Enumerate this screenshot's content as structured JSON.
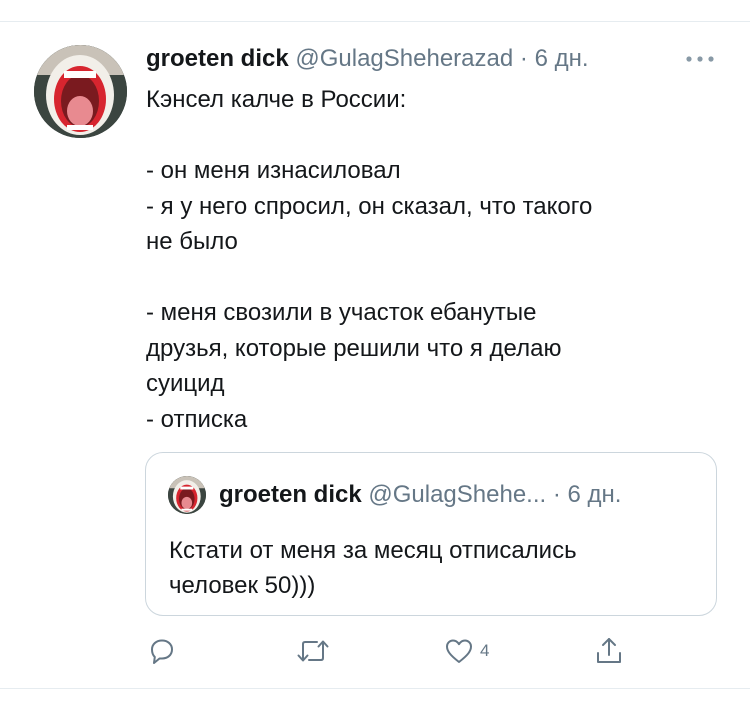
{
  "tweet": {
    "author_name": "groeten dick",
    "handle": "@GulagSheherazad",
    "separator": "·",
    "time": "6 дн.",
    "text_lines": [
      "Кэнсел калче в России:",
      "",
      "- он меня изнасиловал",
      "- я у него спросил, он сказал, что такого",
      "не было",
      "",
      "- меня свозили в участок ебанутые",
      "друзья, которые решили что я делаю",
      "суицид",
      "- отписка"
    ]
  },
  "quote": {
    "author_name": "groeten dick",
    "handle": "@GulagShehe...",
    "separator": "·",
    "time": "6 дн.",
    "text_lines": [
      "Кстати от меня за месяц отписались",
      "человек 50)))"
    ]
  },
  "actions": {
    "reply_icon": "reply-icon",
    "retweet_icon": "retweet-icon",
    "like_icon": "heart-icon",
    "like_count": "4",
    "share_icon": "share-icon",
    "more_icon": "more-icon"
  },
  "colors": {
    "text": "#14171a",
    "secondary": "#657786",
    "divider": "#e6ecf0",
    "card_border": "#ccd6dd"
  }
}
